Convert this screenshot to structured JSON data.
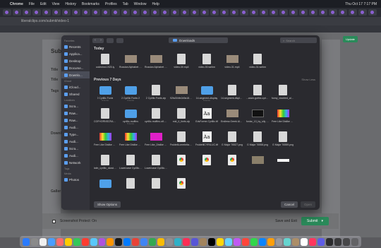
{
  "menubar": {
    "apple": "",
    "app_name": "Chrome",
    "items": [
      "File",
      "Edit",
      "View",
      "History",
      "Bookmarks",
      "Profiles",
      "Tab",
      "Window",
      "Help"
    ],
    "clock": "Thu Oct 17  7:17 PM"
  },
  "browser": {
    "url": "liberalclips.com/submit/video-1"
  },
  "page": {
    "title": "Subm",
    "labels": [
      "Title",
      "Title",
      "Tags",
      "Downl",
      "Galler"
    ],
    "checkbox_label": "Screenshot Protect: On",
    "save_exit": "Save and Exit",
    "submit": "Submit",
    "submit_caret": "▾",
    "update_btn": "Update"
  },
  "dialog": {
    "location": "Downloads",
    "search_placeholder": "Search",
    "sidebar": [
      {
        "section": "Favorites",
        "items": [
          "Recents",
          "Applica...",
          "Desktop",
          "Docume...",
          "Downlo..."
        ]
      },
      {
        "section": "iCloud",
        "items": [
          "iCloud...",
          "Shared"
        ]
      },
      {
        "section": "Locations",
        "items": [
          "Scra...",
          "Raw...",
          "Raw...",
          "Audi...",
          "Type...",
          "Audi...",
          "Scra...",
          "Audi...",
          "Network"
        ]
      },
      {
        "section": "Tags",
        "items": []
      },
      {
        "section": "Media",
        "items": [
          "Photos"
        ]
      }
    ],
    "selected_sidebar": "Downlo...",
    "today_title": "Today",
    "today_files": [
      {
        "name": "codeshot-1920-ly",
        "kind": "doc"
      },
      {
        "name": "Russian Alphabet Dance h...hoho.mp4",
        "kind": "vid"
      },
      {
        "name": "Russian Alphabet Dance h...osuaders",
        "kind": "vid"
      },
      {
        "name": "video-30.mp4",
        "kind": "doc"
      },
      {
        "name": "video-30.webm",
        "kind": "doc"
      },
      {
        "name": "video-31.mp4",
        "kind": "vid"
      },
      {
        "name": "video-31.webm",
        "kind": "doc"
      }
    ],
    "previous_title": "Previous 7 Days",
    "show_less": "Show Less",
    "previous_files": [
      {
        "name": "2 Cyrillic Fonts",
        "meta": "9 items",
        "kind": "fold"
      },
      {
        "name": "2 Cyrillic Fonts 2",
        "meta": "3 items",
        "kind": "fold"
      },
      {
        "name": "2 Cyrillic Fonts.zip",
        "meta": "",
        "kind": "doc"
      },
      {
        "name": "92fa304fe2d9a18b...ccf9968.webm",
        "meta": "",
        "kind": "vid"
      },
      {
        "name": "14-segment-display",
        "meta": "9 items",
        "kind": "fold"
      },
      {
        "name": "14-segment-display.otf.zip",
        "meta": "",
        "kind": "doc"
      },
      {
        "name": "...aram-gothic-cyrillic-...zip.zip",
        "meta": "",
        "kind": "doc"
      },
      {
        "name": "funny_doubled_alpha_by_...ls2d.eot",
        "meta": "",
        "kind": "doc"
      },
      {
        "name": "CGFHORNSCRAH...ARGANA",
        "meta": "",
        "kind": "doc"
      },
      {
        "name": "cyrillic-muffins",
        "meta": "5 items",
        "kind": "fold"
      },
      {
        "name": "cyrillic-muffins.otf.zip",
        "meta": "",
        "kind": "doc"
      },
      {
        "name": "edd_4_fonts.zip",
        "meta": "",
        "kind": "doc"
      },
      {
        "name": "EdvForme-Cyrillic.ttf",
        "meta": "",
        "kind": "aa"
      },
      {
        "name": "Endless Greek Alphabet...ns mp4",
        "meta": "",
        "kind": "vid"
      },
      {
        "name": "fonlar_13_by_sily bobs0d_dfrr.png",
        "meta": "",
        "kind": "blk"
      },
      {
        "name": "Free Like Dislike Logo in...6537.png",
        "meta": "",
        "kind": "rb"
      },
      {
        "name": "Free Like Dislike Logo in...6538.png",
        "meta": "",
        "kind": "rb"
      },
      {
        "name": "Free Like Dislike Logo in...6539.png",
        "meta": "",
        "kind": "rb"
      },
      {
        "name": "Free Like_Dislike Logo in...6019.png",
        "meta": "",
        "kind": "mag"
      },
      {
        "name": "Fruktelli-cerebrita.zip",
        "meta": "",
        "kind": "doc"
      },
      {
        "name": "FruktelliCYRILLIC.ttf",
        "meta": "",
        "kind": "aa"
      },
      {
        "name": "G Major 76527.png",
        "meta": "",
        "kind": "doc"
      },
      {
        "name": "G Major 76558.png",
        "meta": "",
        "kind": "doc"
      },
      {
        "name": "G Major 76559.png",
        "meta": "",
        "kind": "doc"
      },
      {
        "name": "latin_cyrillic_dancing_by...nc_..webm",
        "meta": "",
        "kind": "doc"
      },
      {
        "name": "Lowercase Cyrillic Letters...vol.mp4",
        "meta": "",
        "kind": "doc"
      },
      {
        "name": "Lowercase Cyrillic Letters...fix.webm",
        "meta": "",
        "kind": "doc"
      },
      {
        "name": "",
        "meta": "",
        "kind": "chrome"
      },
      {
        "name": "",
        "meta": "",
        "kind": "chrome"
      },
      {
        "name": "",
        "meta": "",
        "kind": "chrome"
      },
      {
        "name": "",
        "meta": "",
        "kind": "pic"
      },
      {
        "name": "",
        "meta": "",
        "kind": "wht"
      },
      {
        "name": "",
        "meta": "",
        "kind": "fold"
      },
      {
        "name": "",
        "meta": "",
        "kind": "doc"
      },
      {
        "name": "",
        "meta": "",
        "kind": "doc"
      },
      {
        "name": "",
        "meta": "",
        "kind": "chrome"
      }
    ],
    "show_options": "Show Options",
    "cancel": "Cancel",
    "open": "Open"
  },
  "dock_colors": [
    "#2b7bff",
    "#8a8a8a",
    "#f0f0f0",
    "#4a9eff",
    "#ff6b6b",
    "#ffcc00",
    "#34c759",
    "#ff3b30",
    "#5ac8fa",
    "#af52de",
    "#ff9500",
    "#1a1a1a",
    "#007aff",
    "#e94235",
    "#4285f4",
    "#34a853",
    "#fbbc04",
    "#8e8e93",
    "#30b0c7",
    "#ff2d55",
    "#5856d6",
    "#a2845e",
    "#000000",
    "#ffd60a",
    "#64d2ff",
    "#bf5af2",
    "#ff453a",
    "#32d74b",
    "#0a84ff",
    "#ff9f0a",
    "#98989d",
    "#66d4cf",
    "#ac8e68",
    "#ffffff",
    "#ff375f",
    "#5e5ce6",
    "#2c2c2e",
    "#3a3a3c",
    "#48484a",
    "#636366"
  ]
}
